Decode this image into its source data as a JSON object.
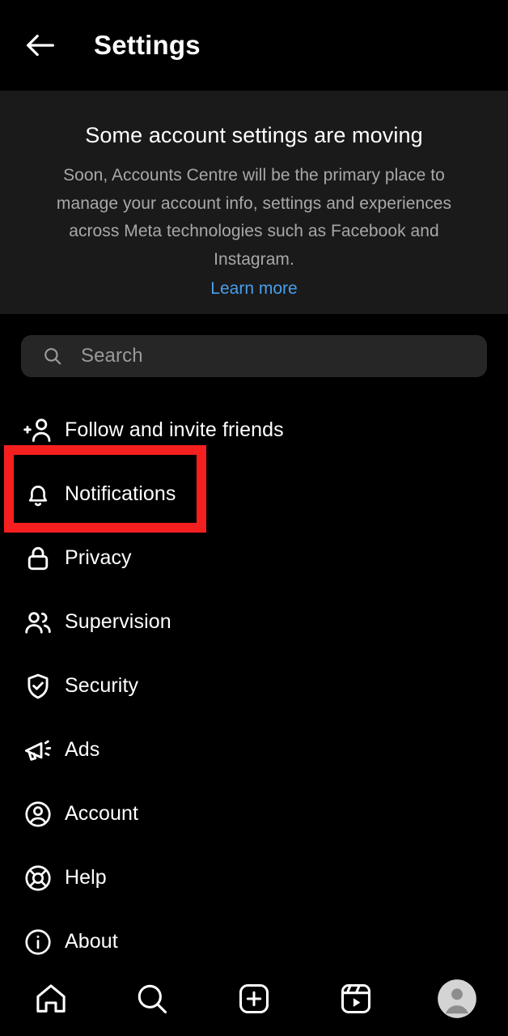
{
  "header": {
    "back_icon": "arrow-left-icon",
    "title": "Settings"
  },
  "banner": {
    "title": "Some account settings are moving",
    "body": "Soon, Accounts Centre will be the primary place to manage your account info, settings and experiences across Meta technologies such as Facebook and Instagram.",
    "link_label": "Learn more",
    "link_color": "#4a9eea",
    "background": "#1a1a1a"
  },
  "search": {
    "icon": "search-icon",
    "placeholder": "Search",
    "value": "",
    "background": "#262626"
  },
  "menu": {
    "items": [
      {
        "label": "Follow and invite friends",
        "icon": "person-add-icon"
      },
      {
        "label": "Notifications",
        "icon": "bell-icon"
      },
      {
        "label": "Privacy",
        "icon": "lock-icon"
      },
      {
        "label": "Supervision",
        "icon": "people-icon"
      },
      {
        "label": "Security",
        "icon": "shield-check-icon"
      },
      {
        "label": "Ads",
        "icon": "megaphone-icon"
      },
      {
        "label": "Account",
        "icon": "account-circle-icon"
      },
      {
        "label": "Help",
        "icon": "life-ring-icon"
      },
      {
        "label": "About",
        "icon": "info-circle-icon"
      }
    ]
  },
  "highlight": {
    "target_label": "Notifications",
    "color": "#f61f1f"
  },
  "bottom_nav": {
    "items": [
      {
        "name": "home",
        "icon": "home-icon"
      },
      {
        "name": "search",
        "icon": "search-icon"
      },
      {
        "name": "create",
        "icon": "plus-square-icon"
      },
      {
        "name": "reels",
        "icon": "reels-icon"
      },
      {
        "name": "profile",
        "icon": "avatar-icon"
      }
    ]
  }
}
